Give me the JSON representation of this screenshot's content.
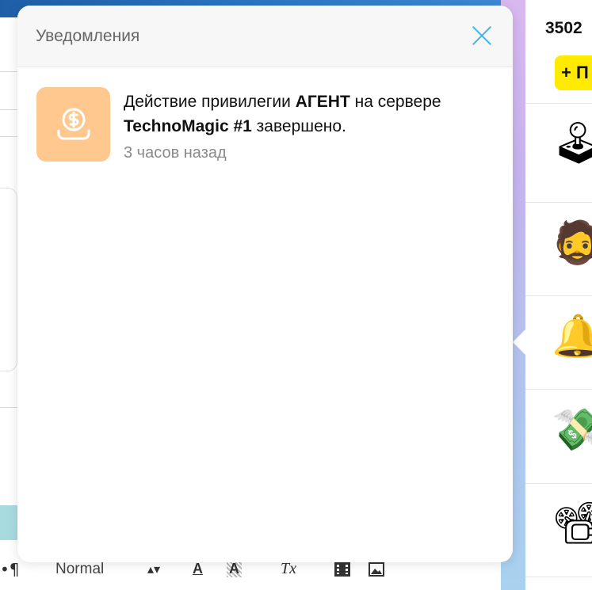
{
  "background": {
    "editor_toolbar": {
      "pilcrow": "•¶",
      "format_select": "Normal",
      "select_arrows": "▴▾",
      "font_color_label": "A",
      "bg_color_label": "A",
      "clear_format_label": "Tx",
      "video_icon": "film-icon",
      "image_icon": "image-icon"
    },
    "right_panel": {
      "count": "3502",
      "add_button_label": "+ П",
      "items": [
        {
          "icon": "joystick-icon",
          "glyph": "🕹"
        },
        {
          "icon": "bearded-man-icon",
          "glyph": "🧔"
        },
        {
          "icon": "bell-icon",
          "glyph": "🔔"
        },
        {
          "icon": "money-wings-icon",
          "glyph": "💸"
        },
        {
          "icon": "film-projector-icon",
          "glyph": "📽"
        }
      ]
    }
  },
  "modal": {
    "title": "Уведомления",
    "close_icon": "close-icon",
    "notifications": [
      {
        "icon": "coin-hand-icon",
        "icon_bg": "#ffc88e",
        "text_pre": "Действие привилегии ",
        "text_bold1": "АГЕНТ",
        "text_mid": " на сервере ",
        "text_bold2": "TechnoMagic #1",
        "text_post": " завершено.",
        "time": "3 часов назад"
      }
    ]
  },
  "colors": {
    "close_accent": "#43b3e8",
    "yellow_button": "#ffea00",
    "notification_icon_bg": "#ffc88e"
  }
}
